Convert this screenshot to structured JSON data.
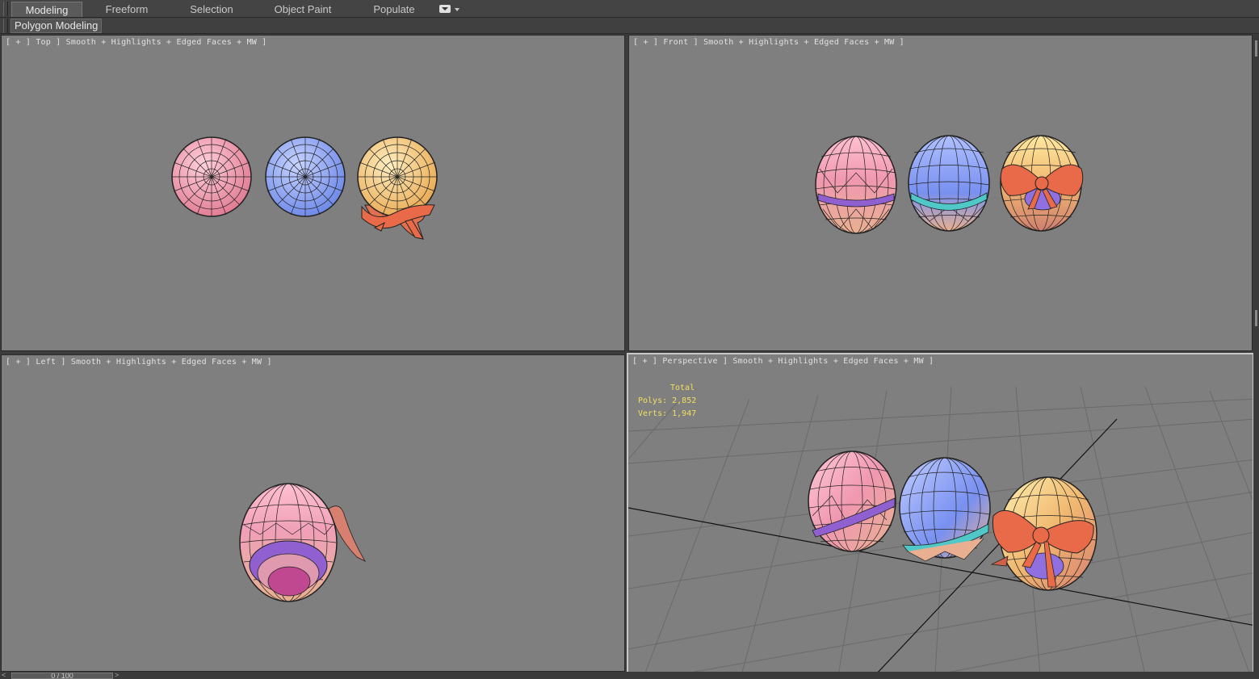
{
  "ribbon": {
    "tabs": [
      {
        "label": "Modeling",
        "active": true
      },
      {
        "label": "Freeform",
        "active": false
      },
      {
        "label": "Selection",
        "active": false
      },
      {
        "label": "Object Paint",
        "active": false
      },
      {
        "label": "Populate",
        "active": false
      }
    ],
    "dropdown_icon": "options-dropdown-icon",
    "panel_label": "Polygon Modeling"
  },
  "viewports": {
    "top": {
      "label": "[ + ] Top ] Smooth + Highlights + Edged Faces + MW ]"
    },
    "front": {
      "label": "[ + ] Front ] Smooth + Highlights + Edged Faces + MW ]"
    },
    "left": {
      "label": "[ + ] Left ] Smooth + Highlights + Edged Faces + MW ]"
    },
    "perspective": {
      "label": "[ + ] Perspective ] Smooth + Highlights + Edged Faces + MW ]",
      "stats": {
        "title": "Total",
        "polys": "Polys: 2,852",
        "verts": "Verts: 1,947"
      }
    }
  },
  "timeline": {
    "frame": "0 / 100",
    "prev": "<",
    "next": ">"
  },
  "colors": {
    "viewport_bg": "#7f7f7f",
    "egg_pink": "#f4a0b8",
    "egg_blue": "#8aa4f4",
    "egg_yellow": "#f4c870",
    "ribbon_red": "#e06040",
    "band_purple": "#9060d0",
    "band_cyan": "#50c8c8",
    "stats_text": "#f0e060"
  }
}
